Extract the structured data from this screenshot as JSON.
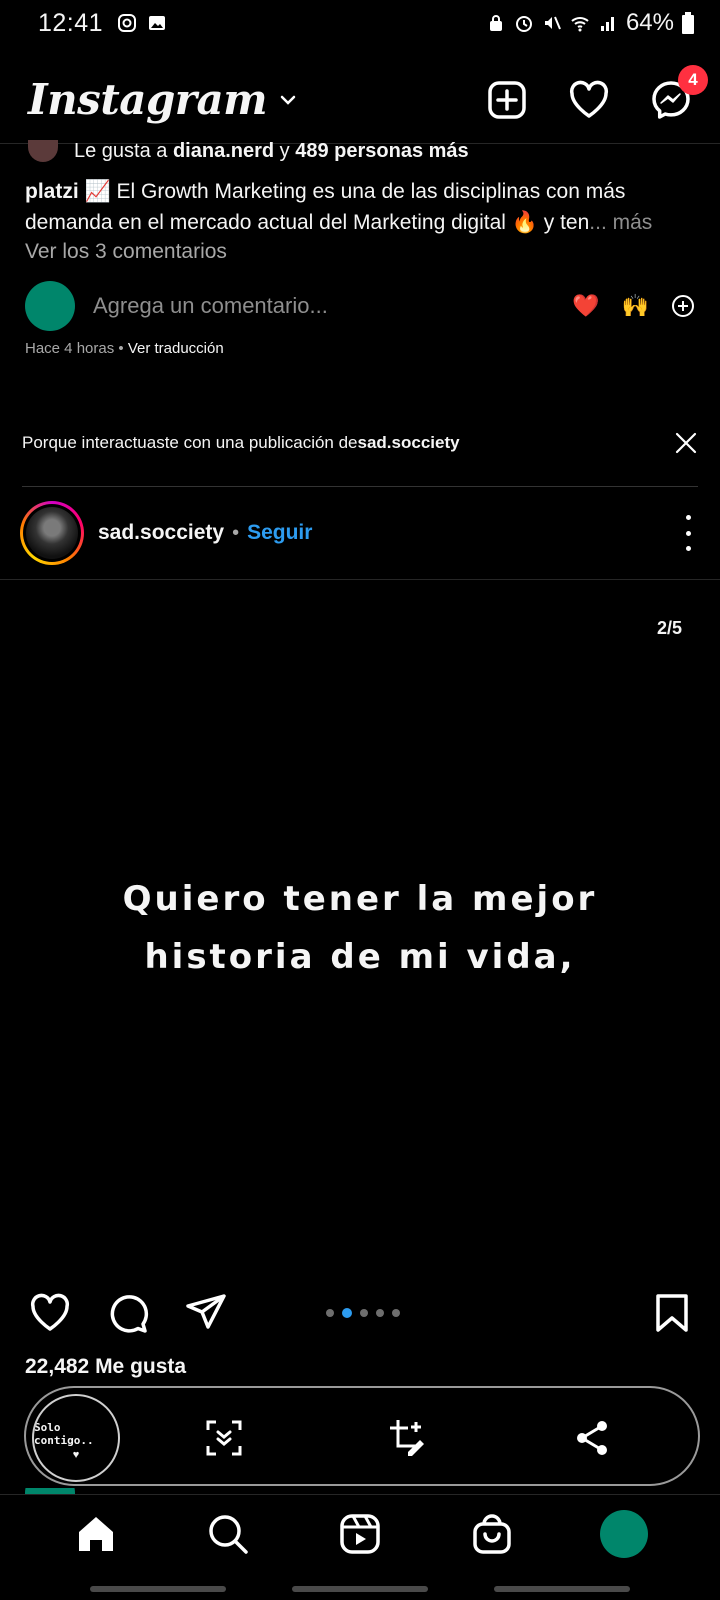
{
  "status_bar": {
    "time": "12:41",
    "battery": "64%"
  },
  "header": {
    "logo": "Instagram",
    "messages_badge": "4"
  },
  "previous_post": {
    "likes_prefix": "Le gusta a ",
    "likes_user": "diana.nerd",
    "likes_mid": " y ",
    "likes_others": "489 personas más",
    "caption_user": "platzi",
    "caption_text": " 📈 El Growth Marketing es una de las disciplinas con más demanda en el mercado actual del Marketing digital 🔥 y ten",
    "caption_more": "... más",
    "view_comments": "Ver los 3 comentarios",
    "comment_placeholder": "Agrega un comentario...",
    "reaction_1": "❤️",
    "reaction_2": "🙌",
    "time_ago": "Hace 4 horas",
    "separator": " • ",
    "translate": "Ver traducción"
  },
  "suggestion": {
    "reason_prefix": "Porque interactuaste con una publicación de ",
    "reason_user": "sad.socciety"
  },
  "post": {
    "username": "sad.socciety",
    "dot": "•",
    "follow_label": "Seguir",
    "counter": "2/5",
    "text_line_1": "Quiero tener la mejor",
    "text_line_2": "historia de mi vida,",
    "likes": "22,482 Me gusta",
    "carousel_total": 5,
    "carousel_current": 2
  },
  "share_bar": {
    "preview_text": "Solo contigo..",
    "preview_heart": "♥"
  },
  "colors": {
    "accent": "#2d9cf0",
    "badge": "#ff3040",
    "avatar": "#00866b"
  }
}
